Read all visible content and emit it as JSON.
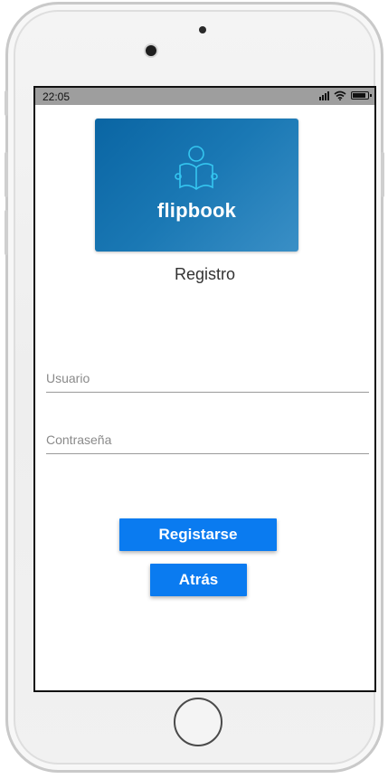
{
  "status_bar": {
    "time": "22:05",
    "signal_icon": "cellular-signal-icon",
    "wifi_icon": "wifi-icon",
    "battery_icon": "battery-icon",
    "battery_level": 0.8
  },
  "logo": {
    "icon": "person-reading-book-icon",
    "text": "flipbook",
    "colors": [
      "#0a65a3",
      "#3a8fc6"
    ]
  },
  "page": {
    "title": "Registro"
  },
  "form": {
    "username_placeholder": "Usuario",
    "username_value": "",
    "password_placeholder": "Contraseña",
    "password_value": ""
  },
  "buttons": {
    "register_label": "Registarse",
    "back_label": "Atrás",
    "color": "#0a7bf0"
  }
}
